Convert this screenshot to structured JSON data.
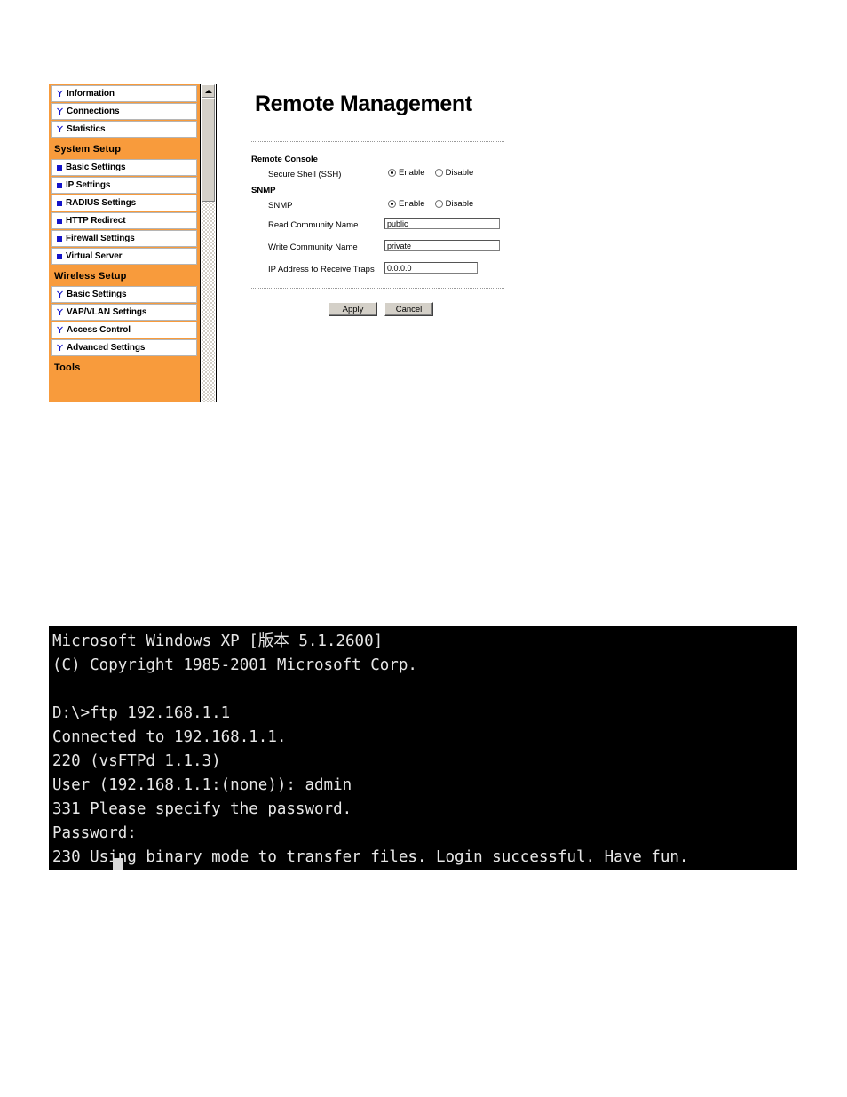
{
  "admin_ui": {
    "sidebar": {
      "scrollbar": {
        "up_arrow": "scroll-up-arrow"
      },
      "sections": [
        {
          "group_label": null,
          "items": [
            {
              "label": "Information",
              "icon": "antenna-icon"
            },
            {
              "label": "Connections",
              "icon": "antenna-icon"
            },
            {
              "label": "Statistics",
              "icon": "antenna-icon"
            }
          ]
        },
        {
          "group_label": "System Setup",
          "items": [
            {
              "label": "Basic Settings",
              "icon": "square-bullet-icon"
            },
            {
              "label": "IP Settings",
              "icon": "square-bullet-icon"
            },
            {
              "label": "RADIUS Settings",
              "icon": "square-bullet-icon"
            },
            {
              "label": "HTTP Redirect",
              "icon": "square-bullet-icon"
            },
            {
              "label": "Firewall Settings",
              "icon": "square-bullet-icon"
            },
            {
              "label": "Virtual Server",
              "icon": "square-bullet-icon"
            }
          ]
        },
        {
          "group_label": "Wireless Setup",
          "items": [
            {
              "label": "Basic Settings",
              "icon": "antenna-icon"
            },
            {
              "label": "VAP/VLAN Settings",
              "icon": "antenna-icon"
            },
            {
              "label": "Access Control",
              "icon": "antenna-icon"
            },
            {
              "label": "Advanced Settings",
              "icon": "antenna-icon"
            }
          ]
        },
        {
          "group_label": "Tools",
          "items": []
        }
      ]
    },
    "main": {
      "title": "Remote Management",
      "remote_console": {
        "heading": "Remote Console",
        "ssh": {
          "label": "Secure Shell (SSH)",
          "enable_label": "Enable",
          "disable_label": "Disable",
          "selected": "Enable"
        }
      },
      "snmp": {
        "heading": "SNMP",
        "snmp_toggle": {
          "label": "SNMP",
          "enable_label": "Enable",
          "disable_label": "Disable",
          "selected": "Enable"
        },
        "read_community": {
          "label": "Read Community Name",
          "value": "public"
        },
        "write_community": {
          "label": "Write Community Name",
          "value": "private"
        },
        "trap_ip": {
          "label": "IP Address to Receive Traps",
          "value": "0.0.0.0"
        }
      },
      "buttons": {
        "apply": "Apply",
        "cancel": "Cancel"
      }
    },
    "colors": {
      "accent_orange": "#F89B3C",
      "bullet_blue": "#1414C8",
      "button_face": "#D4D0C8"
    }
  },
  "console": {
    "text": "Microsoft Windows XP [版本 5.1.2600]\n(C) Copyright 1985-2001 Microsoft Corp.\n\nD:\\>ftp 192.168.1.1\nConnected to 192.168.1.1.\n220 (vsFTPd 1.1.3)\nUser (192.168.1.1:(none)): admin\n331 Please specify the password.\nPassword:\n230 Using binary mode to transfer files. Login successful. Have fun."
  }
}
